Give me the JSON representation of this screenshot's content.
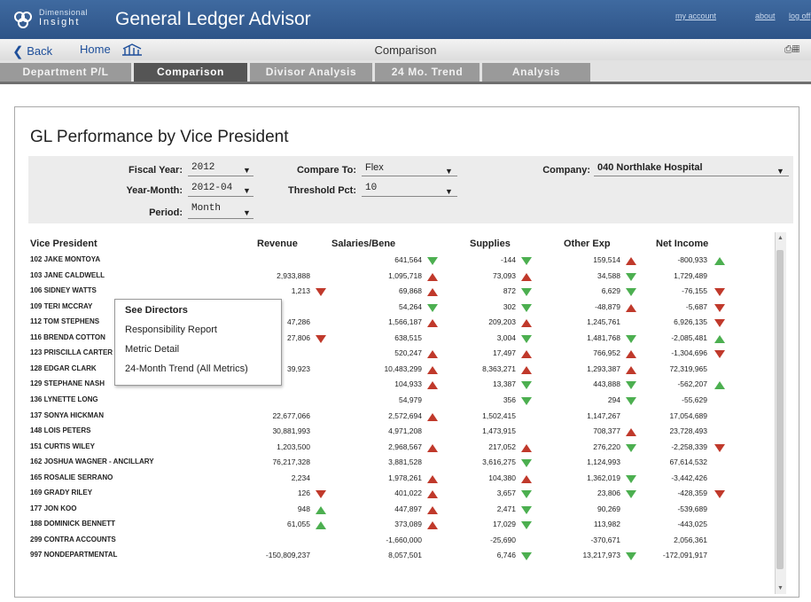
{
  "header": {
    "brand_line1": "Dimensional",
    "brand_line2": "Insight",
    "app_title": "General Ledger Advisor",
    "links": [
      "my account",
      "about",
      "log off"
    ]
  },
  "nav": {
    "back_label": "Back",
    "home_label": "Home",
    "title": "Comparison"
  },
  "tabs": [
    "Department P/L",
    "Comparison",
    "Divisor Analysis",
    "24 Mo. Trend",
    "Analysis"
  ],
  "active_tab": "Comparison",
  "page_title": "GL Performance by Vice President",
  "filters": {
    "fiscal_year": {
      "label": "Fiscal Year:",
      "value": "2012"
    },
    "year_month": {
      "label": "Year-Month:",
      "value": "2012-04"
    },
    "period": {
      "label": "Period:",
      "value": "Month"
    },
    "compare_to": {
      "label": "Compare To:",
      "value": "Flex"
    },
    "threshold_pct": {
      "label": "Threshold Pct:",
      "value": "10"
    },
    "company": {
      "label": "Company:",
      "value": "040 Northlake Hospital"
    }
  },
  "table": {
    "columns": [
      "Vice President",
      "Revenue",
      "Salaries/Bene",
      "Supplies",
      "Other Exp",
      "Net Income"
    ],
    "rows": [
      {
        "name": "102 JAKE MONTOYA",
        "revenue": "",
        "rev_flag": "",
        "sal": "641,564",
        "sal_flag": "down-green",
        "sup": "-144",
        "sup_flag": "down-green",
        "oth": "159,514",
        "oth_flag": "up-red",
        "net": "-800,933",
        "net_flag": "up-green"
      },
      {
        "name": "103 JANE CALDWELL",
        "revenue": "2,933,888",
        "rev_flag": "",
        "sal": "1,095,718",
        "sal_flag": "up-red",
        "sup": "73,093",
        "sup_flag": "up-red",
        "oth": "34,588",
        "oth_flag": "down-green",
        "net": "1,729,489",
        "net_flag": ""
      },
      {
        "name": "106 SIDNEY WATTS",
        "revenue": "1,213",
        "rev_flag": "down-red",
        "sal": "69,868",
        "sal_flag": "up-red",
        "sup": "872",
        "sup_flag": "down-green",
        "oth": "6,629",
        "oth_flag": "down-green",
        "net": "-76,155",
        "net_flag": "down-red"
      },
      {
        "name": "109 TERI MCCRAY",
        "revenue": "",
        "rev_flag": "",
        "sal": "54,264",
        "sal_flag": "down-green",
        "sup": "302",
        "sup_flag": "down-green",
        "oth": "-48,879",
        "oth_flag": "up-red",
        "net": "-5,687",
        "net_flag": "down-red"
      },
      {
        "name": "112 TOM STEPHENS",
        "revenue": "47,286",
        "rev_flag": "",
        "sal": "1,566,187",
        "sal_flag": "up-red",
        "sup": "209,203",
        "sup_flag": "up-red",
        "oth": "1,245,761",
        "oth_flag": "",
        "net": "6,926,135",
        "net_flag": "down-red"
      },
      {
        "name": "116 BRENDA COTTON",
        "revenue": "27,806",
        "rev_flag": "down-red",
        "sal": "638,515",
        "sal_flag": "",
        "sup": "3,004",
        "sup_flag": "down-green",
        "oth": "1,481,768",
        "oth_flag": "down-green",
        "net": "-2,085,481",
        "net_flag": "up-green"
      },
      {
        "name": "123 PRISCILLA CARTER",
        "revenue": "",
        "rev_flag": "",
        "sal": "520,247",
        "sal_flag": "up-red",
        "sup": "17,497",
        "sup_flag": "up-red",
        "oth": "766,952",
        "oth_flag": "up-red",
        "net": "-1,304,696",
        "net_flag": "down-red"
      },
      {
        "name": "128 EDGAR CLARK",
        "revenue": "39,923",
        "rev_flag": "",
        "sal": "10,483,299",
        "sal_flag": "up-red",
        "sup": "8,363,271",
        "sup_flag": "up-red",
        "oth": "1,293,387",
        "oth_flag": "up-red",
        "net": "72,319,965",
        "net_flag": ""
      },
      {
        "name": "129 STEPHANE NASH",
        "revenue": "",
        "rev_flag": "",
        "sal": "104,933",
        "sal_flag": "up-red",
        "sup": "13,387",
        "sup_flag": "down-green",
        "oth": "443,888",
        "oth_flag": "down-green",
        "net": "-562,207",
        "net_flag": "up-green"
      },
      {
        "name": "136 LYNETTE LONG",
        "revenue": "",
        "rev_flag": "",
        "sal": "54,979",
        "sal_flag": "",
        "sup": "356",
        "sup_flag": "down-green",
        "oth": "294",
        "oth_flag": "down-green",
        "net": "-55,629",
        "net_flag": ""
      },
      {
        "name": "137 SONYA HICKMAN",
        "revenue": "22,677,066",
        "rev_flag": "",
        "sal": "2,572,694",
        "sal_flag": "up-red",
        "sup": "1,502,415",
        "sup_flag": "",
        "oth": "1,147,267",
        "oth_flag": "",
        "net": "17,054,689",
        "net_flag": ""
      },
      {
        "name": "148 LOIS PETERS",
        "revenue": "30,881,993",
        "rev_flag": "",
        "sal": "4,971,208",
        "sal_flag": "",
        "sup": "1,473,915",
        "sup_flag": "",
        "oth": "708,377",
        "oth_flag": "up-red",
        "net": "23,728,493",
        "net_flag": ""
      },
      {
        "name": "151 CURTIS WILEY",
        "revenue": "1,203,500",
        "rev_flag": "",
        "sal": "2,968,567",
        "sal_flag": "up-red",
        "sup": "217,052",
        "sup_flag": "up-red",
        "oth": "276,220",
        "oth_flag": "down-green",
        "net": "-2,258,339",
        "net_flag": "down-red"
      },
      {
        "name": "162 JOSHUA WAGNER - ANCILLARY",
        "revenue": "76,217,328",
        "rev_flag": "",
        "sal": "3,881,528",
        "sal_flag": "",
        "sup": "3,616,275",
        "sup_flag": "down-green",
        "oth": "1,124,993",
        "oth_flag": "",
        "net": "67,614,532",
        "net_flag": ""
      },
      {
        "name": "165 ROSALIE SERRANO",
        "revenue": "2,234",
        "rev_flag": "",
        "sal": "1,978,261",
        "sal_flag": "up-red",
        "sup": "104,380",
        "sup_flag": "up-red",
        "oth": "1,362,019",
        "oth_flag": "down-green",
        "net": "-3,442,426",
        "net_flag": ""
      },
      {
        "name": "169 GRADY RILEY",
        "revenue": "126",
        "rev_flag": "down-red",
        "sal": "401,022",
        "sal_flag": "up-red",
        "sup": "3,657",
        "sup_flag": "down-green",
        "oth": "23,806",
        "oth_flag": "down-green",
        "net": "-428,359",
        "net_flag": "down-red"
      },
      {
        "name": "177 JON KOO",
        "revenue": "948",
        "rev_flag": "up-green",
        "sal": "447,897",
        "sal_flag": "up-red",
        "sup": "2,471",
        "sup_flag": "down-green",
        "oth": "90,269",
        "oth_flag": "",
        "net": "-539,689",
        "net_flag": ""
      },
      {
        "name": "188 DOMINICK BENNETT",
        "revenue": "61,055",
        "rev_flag": "up-green",
        "sal": "373,089",
        "sal_flag": "up-red",
        "sup": "17,029",
        "sup_flag": "down-green",
        "oth": "113,982",
        "oth_flag": "",
        "net": "-443,025",
        "net_flag": ""
      },
      {
        "name": "299 CONTRA ACCOUNTS",
        "revenue": "",
        "rev_flag": "",
        "sal": "-1,660,000",
        "sal_flag": "",
        "sup": "-25,690",
        "sup_flag": "",
        "oth": "-370,671",
        "oth_flag": "",
        "net": "2,056,361",
        "net_flag": ""
      },
      {
        "name": "997 NONDEPARTMENTAL",
        "revenue": "-150,809,237",
        "rev_flag": "",
        "sal": "8,057,501",
        "sal_flag": "",
        "sup": "6,746",
        "sup_flag": "down-green",
        "oth": "13,217,973",
        "oth_flag": "down-green",
        "net": "-172,091,917",
        "net_flag": ""
      }
    ]
  },
  "context_menu": [
    "See Directors",
    "Responsibility Report",
    "Metric Detail",
    "24-Month Trend (All Metrics)"
  ],
  "colors": {
    "header_blue": "#2e5488",
    "up_red": "#c0392b",
    "down_green": "#4caf50",
    "tab_gray": "#9a9a9a",
    "tab_active": "#555555"
  }
}
